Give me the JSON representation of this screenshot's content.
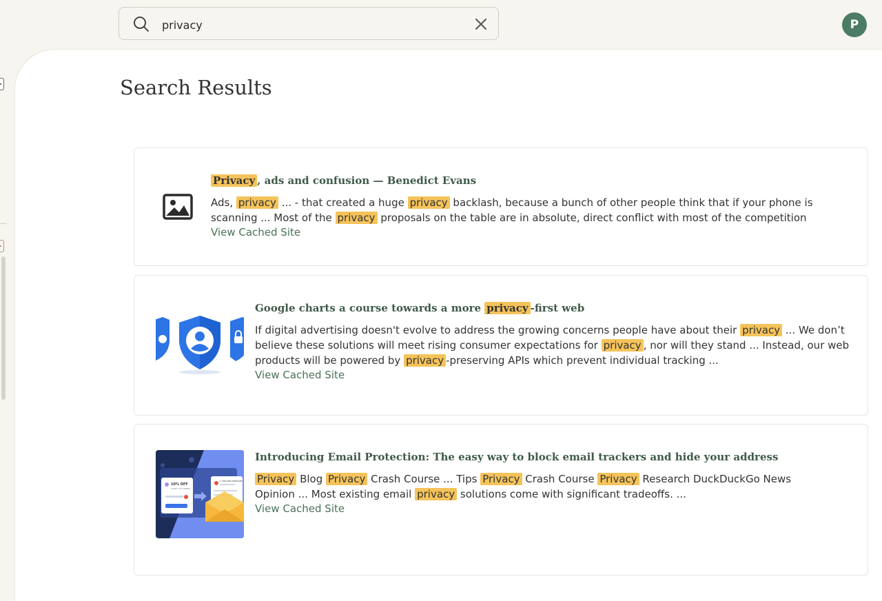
{
  "search": {
    "value": "privacy"
  },
  "user": {
    "initial": "P"
  },
  "page": {
    "title": "Search Results"
  },
  "results": [
    {
      "title_highlight": "Privacy",
      "title_rest": ", ads and confusion — Benedict Evans",
      "snippet": [
        {
          "t": "Ads, "
        },
        {
          "h": "privacy"
        },
        {
          "t": "  ...  - that created a huge "
        },
        {
          "h": "privacy"
        },
        {
          "t": " backlash, because a bunch of other people think that if your phone is scanning  ...  Most of the "
        },
        {
          "h": "privacy"
        },
        {
          "t": " proposals on the table are in absolute, direct conflict with most of the competition"
        }
      ],
      "cached": "View Cached Site",
      "thumbnail": "image-placeholder-icon"
    },
    {
      "title_before": "Google charts a course towards a more ",
      "title_highlight": "privacy",
      "title_after": "-first web",
      "snippet": [
        {
          "t": "If digital advertising doesn't evolve to address the growing concerns people have about their "
        },
        {
          "h": "privacy"
        },
        {
          "t": "  ...  We don’t believe these solutions will meet rising consumer expectations for "
        },
        {
          "h": "privacy"
        },
        {
          "t": ", nor will they stand  ...  Instead, our web products will be powered by "
        },
        {
          "h": "privacy"
        },
        {
          "t": "-preserving APIs which prevent individual tracking  ..."
        }
      ],
      "cached": "View Cached Site",
      "thumbnail": "privacy-shield-icon"
    },
    {
      "title": "Introducing Email Protection: The easy way to block email trackers and hide your address",
      "snippet": [
        {
          "h": "Privacy"
        },
        {
          "t": " Blog "
        },
        {
          "h": "Privacy"
        },
        {
          "t": " Crash Course  ...  Tips "
        },
        {
          "h": "Privacy"
        },
        {
          "t": " Crash Course "
        },
        {
          "h": "Privacy"
        },
        {
          "t": " Research DuckDuckGo News Opinion  ...  Most existing email "
        },
        {
          "h": "privacy"
        },
        {
          "t": " solutions come with significant tradeoffs.  ..."
        }
      ],
      "cached": "View Cached Site",
      "thumbnail": "email-protection-illustration",
      "thumb_text": {
        "offer": "10% OFF",
        "offer_sub": "CODE: 1ST ORDER",
        "tracker": "1 TRACKER REMOVED"
      }
    }
  ],
  "colors": {
    "highlight": "#f5c35a",
    "title": "#3f5a48",
    "link": "#4a7157",
    "avatar": "#4d7c65"
  }
}
